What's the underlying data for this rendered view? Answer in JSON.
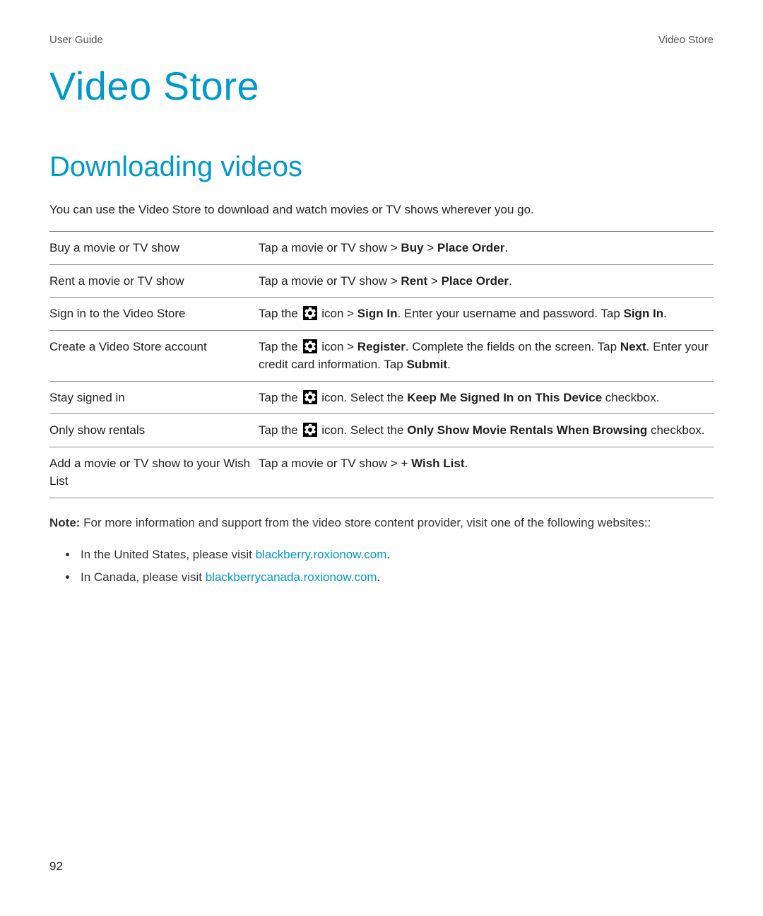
{
  "header": {
    "left": "User Guide",
    "right": "Video Store"
  },
  "title": "Video Store",
  "section": "Downloading videos",
  "intro": "You can use the Video Store to download and watch movies or TV shows wherever you go.",
  "table": {
    "rows": [
      {
        "task": "Buy a movie or TV show",
        "pre": "Tap a movie or TV show > ",
        "b1": "Buy",
        "mid": " > ",
        "b2": "Place Order",
        "post": "."
      },
      {
        "task": "Rent a movie or TV show",
        "pre": "Tap a movie or TV show > ",
        "b1": "Rent",
        "mid": " > ",
        "b2": "Place Order",
        "post": "."
      },
      {
        "task": "Sign in to the Video Store",
        "pre": "Tap the ",
        "aftericon": " icon > ",
        "b1": "Sign In",
        "mid": ". Enter your username and password. Tap ",
        "b2": "Sign In",
        "post": "."
      },
      {
        "task": "Create a Video Store account",
        "pre": "Tap the ",
        "aftericon": " icon > ",
        "b1": "Register",
        "mid": ". Complete the fields on the screen. Tap ",
        "b2": "Next",
        "mid2": ". Enter your credit card information. Tap ",
        "b3": "Submit",
        "post": "."
      },
      {
        "task": "Stay signed in",
        "pre": "Tap the ",
        "aftericon": " icon. Select the ",
        "b1": "Keep Me Signed In on This Device",
        "post": " checkbox."
      },
      {
        "task": "Only show rentals",
        "pre": "Tap the ",
        "aftericon": " icon. Select the ",
        "b1": "Only Show Movie Rentals When Browsing",
        "post": " checkbox."
      },
      {
        "task": "Add a movie or TV show to your Wish List",
        "pre": "Tap a movie or TV show > + ",
        "b1": "Wish List",
        "post": "."
      }
    ]
  },
  "note": {
    "label": "Note:",
    "text": " For more information and support from the video store content provider, visit one of the following websites::"
  },
  "links": [
    {
      "pre": "In the United States, please visit ",
      "url": "blackberry.roxionow.com",
      "post": "."
    },
    {
      "pre": "In Canada, please visit ",
      "url": "blackberrycanada.roxionow.com",
      "post": "."
    }
  ],
  "pagenum": "92"
}
